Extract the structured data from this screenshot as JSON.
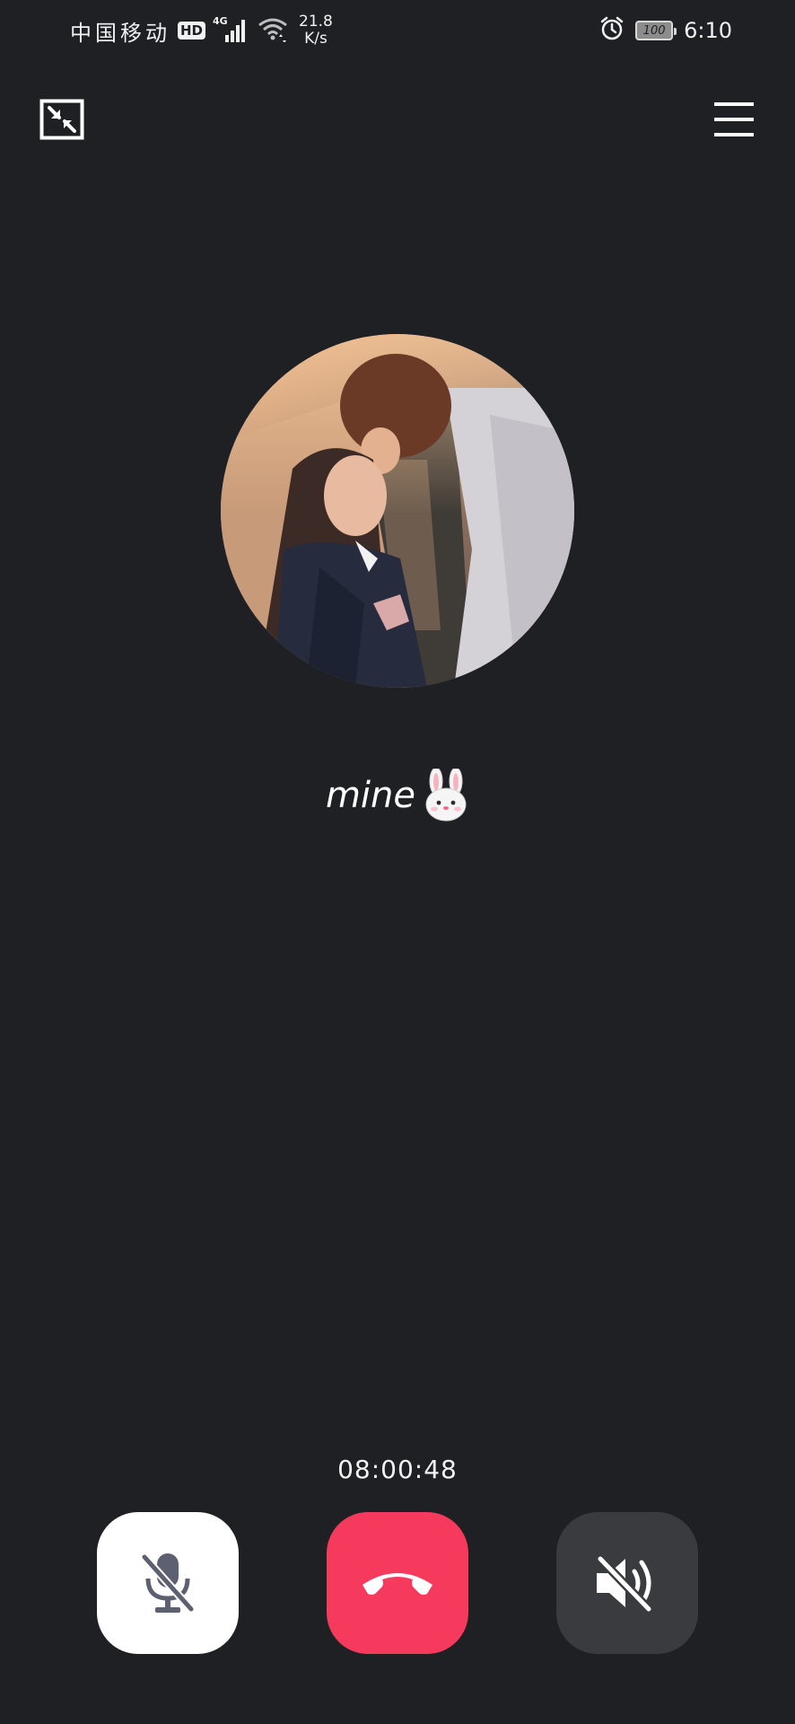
{
  "status_bar": {
    "carrier": "中国移动",
    "hd_badge": "HD",
    "network_type": "4G",
    "net_speed_value": "21.8",
    "net_speed_unit": "K/s",
    "battery_level": "100",
    "time": "6:10",
    "icons": [
      "signal-icon",
      "wifi-icon",
      "alarm-icon",
      "battery-icon"
    ]
  },
  "top_bar": {
    "icons": [
      "minimize-window-icon",
      "menu-icon"
    ]
  },
  "contact": {
    "name": "mine",
    "emoji_icon": "rabbit-face-icon"
  },
  "call": {
    "timer": "08:00:48",
    "controls": [
      {
        "name": "mute",
        "icon": "microphone-off-icon",
        "color": "#ffffff"
      },
      {
        "name": "hangup",
        "icon": "phone-hangup-icon",
        "color": "#f63a5e"
      },
      {
        "name": "speaker",
        "icon": "speaker-off-icon",
        "color": "#3a3b3e"
      }
    ]
  },
  "colors": {
    "background": "#1f2023",
    "hangup": "#f63a5e",
    "mute_bg": "#ffffff",
    "speaker_bg": "#3a3b3e",
    "icon_gray": "#5c6070"
  }
}
